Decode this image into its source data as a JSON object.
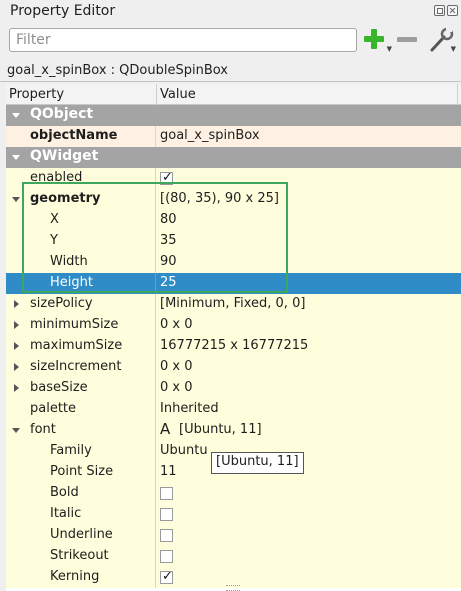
{
  "window": {
    "title": "Property Editor"
  },
  "toolbar": {
    "filter_placeholder": "Filter",
    "add_icon": "plus-icon",
    "remove_icon": "minus-icon",
    "configure_icon": "wrench-icon",
    "accent": "#38b52b"
  },
  "object_line": "goal_x_spinBox : QDoubleSpinBox",
  "header": {
    "property": "Property",
    "value": "Value"
  },
  "rows": {
    "qobject": {
      "label": "QObject"
    },
    "objectName": {
      "label": "objectName",
      "value": "goal_x_spinBox"
    },
    "qwidget": {
      "label": "QWidget"
    },
    "enabled": {
      "label": "enabled",
      "checked": true
    },
    "geometry": {
      "label": "geometry",
      "value": "[(80, 35), 90 x 25]"
    },
    "x": {
      "label": "X",
      "value": "80"
    },
    "y": {
      "label": "Y",
      "value": "35"
    },
    "width": {
      "label": "Width",
      "value": "90"
    },
    "height": {
      "label": "Height",
      "value": "25"
    },
    "sizePolicy": {
      "label": "sizePolicy",
      "value": "[Minimum, Fixed, 0, 0]"
    },
    "minimumSize": {
      "label": "minimumSize",
      "value": "0 x 0"
    },
    "maximumSize": {
      "label": "maximumSize",
      "value": "16777215 x 16777215"
    },
    "sizeIncrement": {
      "label": "sizeIncrement",
      "value": "0 x 0"
    },
    "baseSize": {
      "label": "baseSize",
      "value": "0 x 0"
    },
    "palette": {
      "label": "palette",
      "value": "Inherited"
    },
    "font": {
      "label": "font",
      "icon_glyph": "A",
      "value": "[Ubuntu, 11]"
    },
    "family": {
      "label": "Family",
      "value": "Ubuntu"
    },
    "pointSize": {
      "label": "Point Size",
      "value": "11"
    },
    "bold": {
      "label": "Bold",
      "checked": false
    },
    "italic": {
      "label": "Italic",
      "checked": false
    },
    "underline": {
      "label": "Underline",
      "checked": false
    },
    "strikeout": {
      "label": "Strikeout",
      "checked": false
    },
    "kerning": {
      "label": "Kerning",
      "checked": true
    }
  },
  "tooltip": "[Ubuntu, 11]",
  "colors": {
    "category_bg": "#a4a4a4",
    "selection": "#308cc6",
    "highlight_box": "#3da85d",
    "row_yellow": "#fefedc",
    "row_peach": "#fef0e2"
  }
}
